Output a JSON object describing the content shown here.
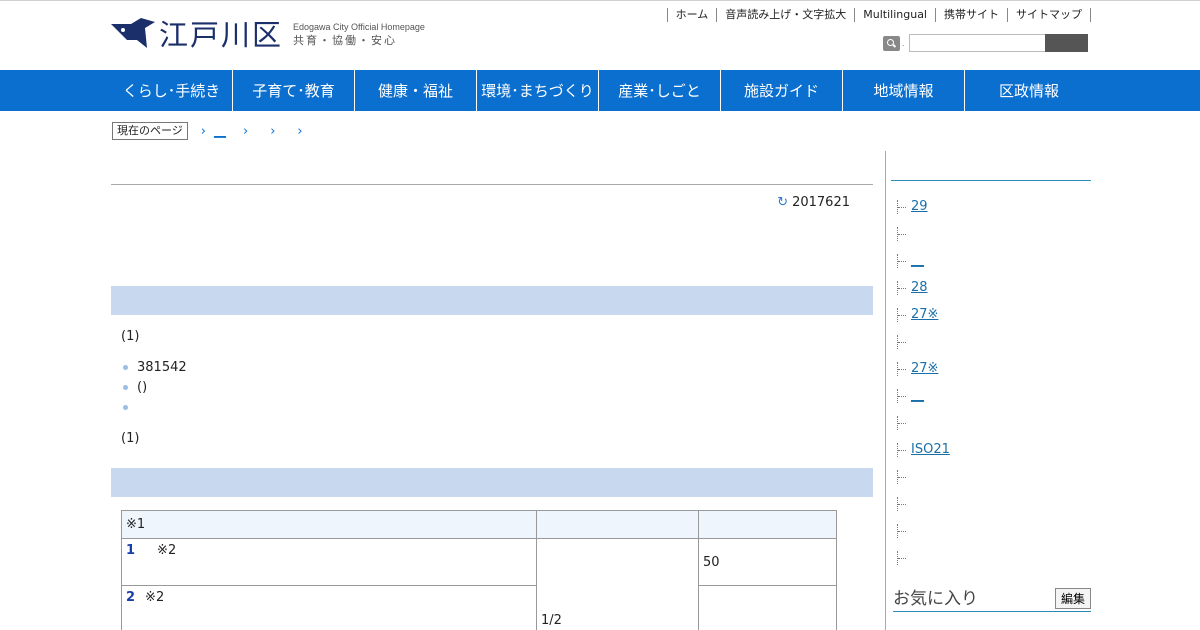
{
  "header": {
    "logo_text": "江戸川区",
    "logo_en": "Edogawa City Official Homepage",
    "logo_jp": "共育・協働・安心",
    "util_links": [
      "ホーム",
      "音声読み上げ・文字拡大",
      "Multilingual",
      "携帯サイト",
      "サイトマップ"
    ],
    "search": {
      "value": "",
      "placeholder": ""
    }
  },
  "gnav": [
    "くらし･手続き",
    "子育て･教育",
    "健康・福祉",
    "環境･まちづくり",
    "産業･しごと",
    "施設ガイド",
    "地域情報",
    "区政情報"
  ],
  "breadcrumb": {
    "label": "現在のページ",
    "link": "__"
  },
  "main": {
    "updated": "2017621",
    "para1": "(1)",
    "bullets": [
      "381542",
      "()",
      ""
    ],
    "para2": "(1)",
    "table": {
      "head": [
        "※1",
        "",
        ""
      ],
      "row1": {
        "num": "1",
        "text": "※2",
        "mid": "1/2",
        "right": "50"
      },
      "row2": {
        "num": "2",
        "text": "※2",
        "right": ""
      }
    }
  },
  "sidebar": {
    "items": [
      {
        "text": "29",
        "link": true
      },
      {
        "text": "",
        "link": false
      },
      {
        "text": "__",
        "link": true
      },
      {
        "text": "28",
        "link": true
      },
      {
        "text": "27※",
        "link": true
      },
      {
        "text": "",
        "link": false
      },
      {
        "text": "27※",
        "link": true
      },
      {
        "text": "__",
        "link": true
      },
      {
        "text": "",
        "link": false
      },
      {
        "text": "ISO21",
        "link": true
      },
      {
        "text": "",
        "link": false
      },
      {
        "text": "",
        "link": true
      },
      {
        "text": "",
        "link": false
      },
      {
        "text": "",
        "link": false
      }
    ],
    "favorites_title": "お気に入り",
    "favorites_edit": "編集"
  },
  "colors": {
    "nav": "#0a6fcf",
    "section": "#c8d9ef",
    "link": "#1b6fa8"
  }
}
